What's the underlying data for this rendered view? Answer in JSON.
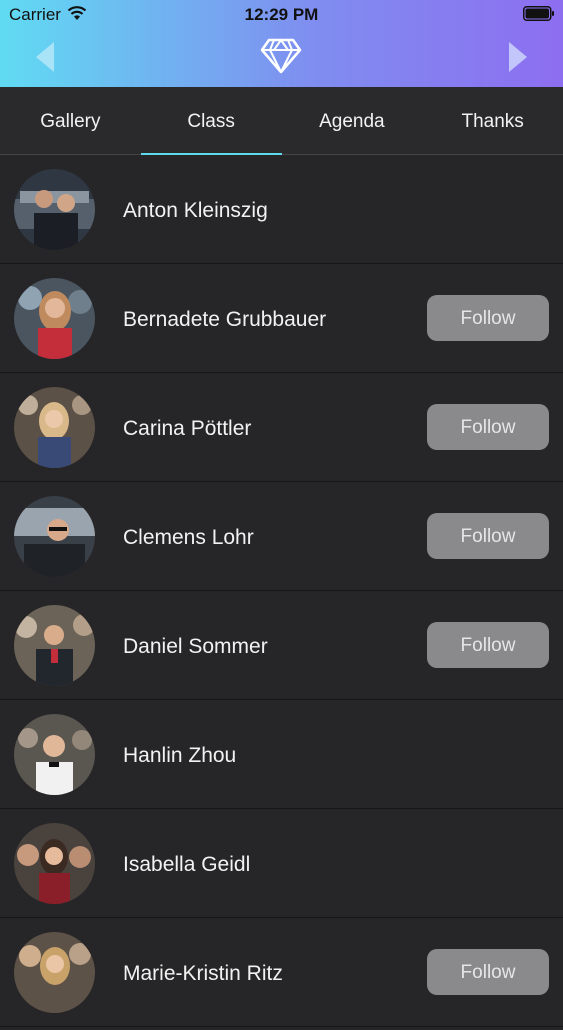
{
  "status_bar": {
    "carrier": "Carrier",
    "time": "12:29 PM"
  },
  "header": {
    "back_icon": "chevron-left-icon",
    "logo_icon": "diamond-icon",
    "forward_icon": "chevron-right-icon",
    "gradient": [
      "#60dbf2",
      "#8d6ef0"
    ]
  },
  "tabs": [
    {
      "label": "Gallery",
      "active": false
    },
    {
      "label": "Class",
      "active": true
    },
    {
      "label": "Agenda",
      "active": false
    },
    {
      "label": "Thanks",
      "active": false
    }
  ],
  "accent_color": "#5fd9ec",
  "people": [
    {
      "name": "Anton Kleinszig",
      "follow": ""
    },
    {
      "name": "Bernadete Grubbauer",
      "follow": "Follow"
    },
    {
      "name": "Carina Pöttler",
      "follow": "Follow"
    },
    {
      "name": "Clemens Lohr",
      "follow": "Follow"
    },
    {
      "name": "Daniel Sommer",
      "follow": "Follow"
    },
    {
      "name": "Hanlin Zhou",
      "follow": ""
    },
    {
      "name": "Isabella Geidl",
      "follow": ""
    },
    {
      "name": "Marie-Kristin Ritz",
      "follow": "Follow"
    }
  ]
}
